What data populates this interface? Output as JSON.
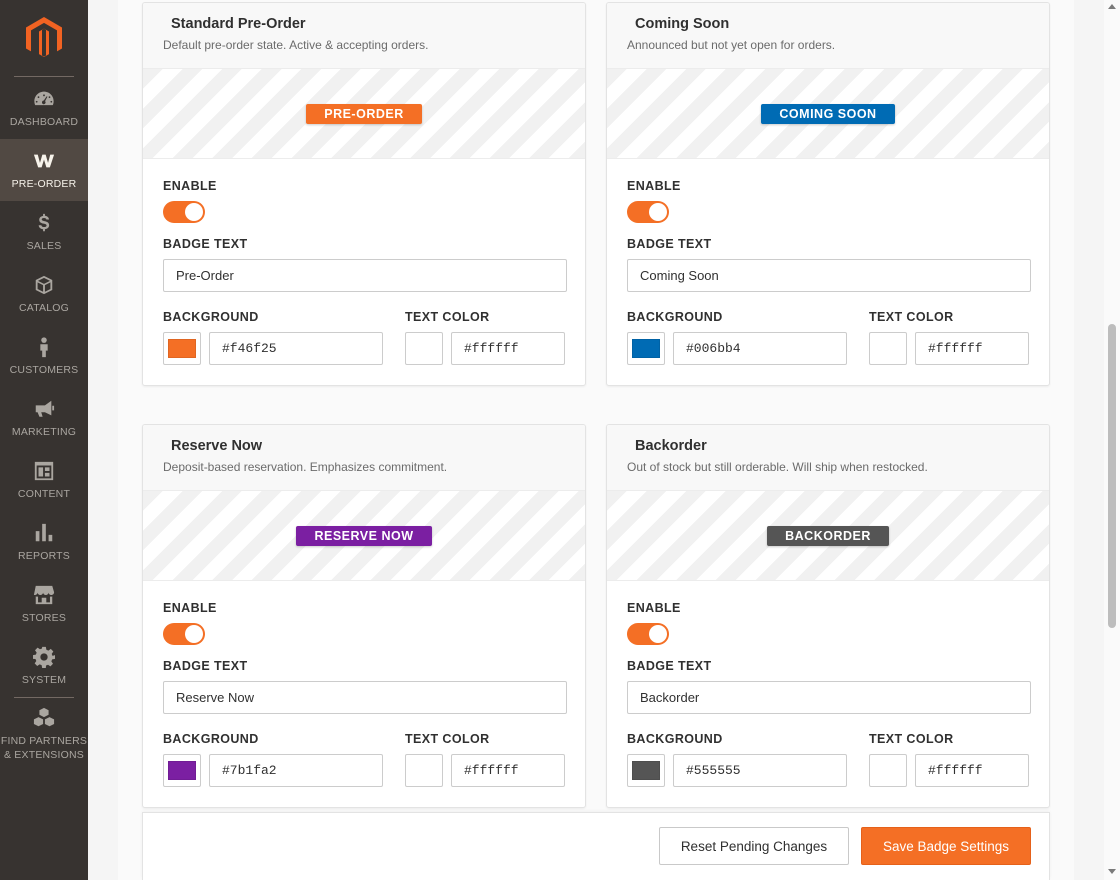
{
  "sidebar": {
    "items": [
      {
        "label": "DASHBOARD",
        "icon": "dashboard-icon"
      },
      {
        "label": "PRE-ORDER",
        "icon": "w-logo-icon",
        "active": true
      },
      {
        "label": "SALES",
        "icon": "dollar-icon"
      },
      {
        "label": "CATALOG",
        "icon": "cube-icon"
      },
      {
        "label": "CUSTOMERS",
        "icon": "person-icon"
      },
      {
        "label": "MARKETING",
        "icon": "megaphone-icon"
      },
      {
        "label": "CONTENT",
        "icon": "layout-icon"
      },
      {
        "label": "REPORTS",
        "icon": "bar-chart-icon"
      },
      {
        "label": "STORES",
        "icon": "store-icon"
      },
      {
        "label": "SYSTEM",
        "icon": "gear-icon"
      },
      {
        "label": "FIND PARTNERS & EXTENSIONS",
        "icon": "boxes-icon"
      }
    ]
  },
  "labels": {
    "enable": "ENABLE",
    "badge_text": "BADGE TEXT",
    "background": "BACKGROUND",
    "text_color": "TEXT COLOR"
  },
  "cards": [
    {
      "title": "Standard Pre-Order",
      "description": "Default pre-order state. Active & accepting orders.",
      "badge": "PRE-ORDER",
      "text": "Pre-Order",
      "bg": "#f46f25",
      "fg": "#ffffff",
      "enabled": true
    },
    {
      "title": "Coming Soon",
      "description": "Announced but not yet open for orders.",
      "badge": "COMING SOON",
      "text": "Coming Soon",
      "bg": "#006bb4",
      "fg": "#ffffff",
      "enabled": true
    },
    {
      "title": "Reserve Now",
      "description": "Deposit-based reservation. Emphasizes commitment.",
      "badge": "RESERVE NOW",
      "text": "Reserve Now",
      "bg": "#7b1fa2",
      "fg": "#ffffff",
      "enabled": true
    },
    {
      "title": "Backorder",
      "description": "Out of stock but still orderable. Will ship when restocked.",
      "badge": "BACKORDER",
      "text": "Backorder",
      "bg": "#555555",
      "fg": "#ffffff",
      "enabled": true
    }
  ],
  "footer": {
    "reset_label": "Reset Pending Changes",
    "save_label": "Save Badge Settings"
  },
  "colors": {
    "accent": "#f46f25",
    "sidebar_bg": "#373330",
    "sidebar_active": "#514943"
  }
}
